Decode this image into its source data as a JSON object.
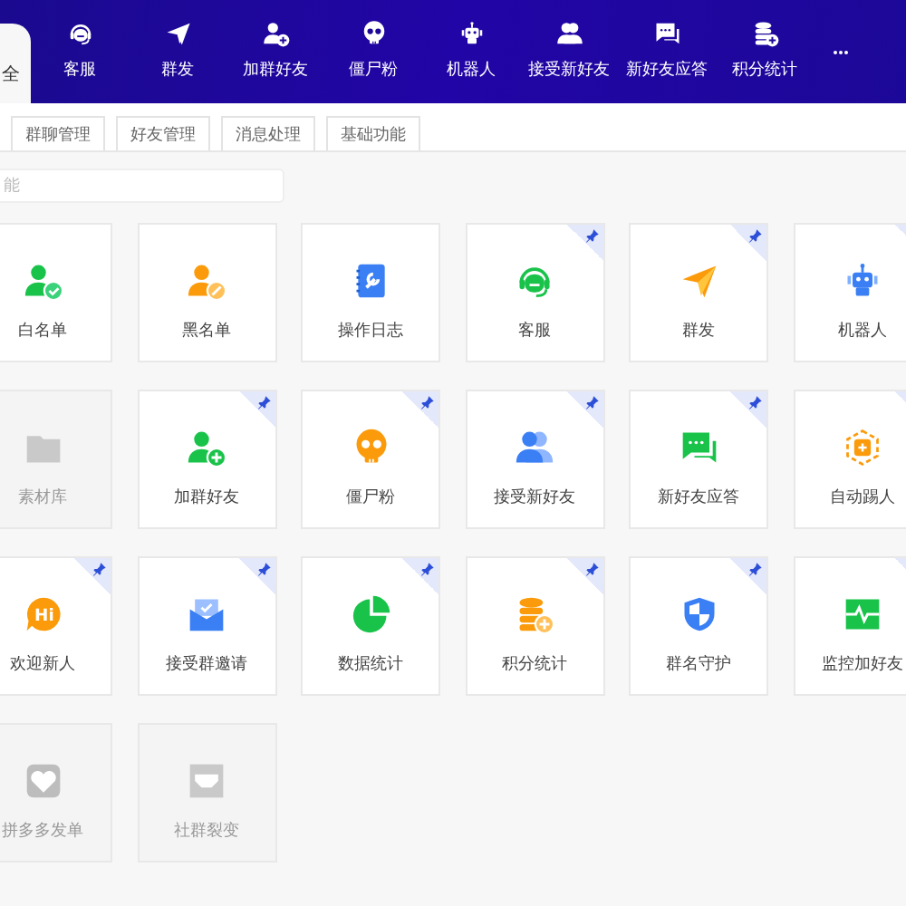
{
  "nav": {
    "current_tab": {
      "label": "全",
      "selected": true
    },
    "items": [
      {
        "label": "客服",
        "kind": "headset"
      },
      {
        "label": "群发",
        "kind": "send"
      },
      {
        "label": "加群好友",
        "kind": "user-add"
      },
      {
        "label": "僵尸粉",
        "kind": "skull"
      },
      {
        "label": "机器人",
        "kind": "robot"
      },
      {
        "label": "接受新好友",
        "kind": "users"
      },
      {
        "label": "新好友应答",
        "kind": "chat"
      },
      {
        "label": "积分统计",
        "kind": "coins"
      }
    ]
  },
  "tabs": [
    {
      "label": "群聊管理",
      "selected": false
    },
    {
      "label": "好友管理",
      "selected": false
    },
    {
      "label": "消息处理",
      "selected": false
    },
    {
      "label": "基础功能",
      "selected": false
    }
  ],
  "search": {
    "placeholder": "能"
  },
  "cards": [
    {
      "label": "白名单",
      "kind": "user-check",
      "pinned": false,
      "disabled": false
    },
    {
      "label": "黑名单",
      "kind": "user-edit",
      "pinned": false,
      "disabled": false
    },
    {
      "label": "操作日志",
      "kind": "book",
      "pinned": false,
      "disabled": false
    },
    {
      "label": "客服",
      "kind": "headset",
      "pinned": true,
      "disabled": false
    },
    {
      "label": "群发",
      "kind": "send",
      "pinned": true,
      "disabled": false
    },
    {
      "label": "机器人",
      "kind": "robot",
      "pinned": true,
      "disabled": false
    },
    {
      "label": "素材库",
      "kind": "folder",
      "pinned": false,
      "disabled": true
    },
    {
      "label": "加群好友",
      "kind": "user-add",
      "pinned": true,
      "disabled": false
    },
    {
      "label": "僵尸粉",
      "kind": "skull",
      "pinned": true,
      "disabled": false
    },
    {
      "label": "接受新好友",
      "kind": "users",
      "pinned": true,
      "disabled": false
    },
    {
      "label": "新好友应答",
      "kind": "chat",
      "pinned": true,
      "disabled": false
    },
    {
      "label": "自动踢人",
      "kind": "hexagon",
      "pinned": true,
      "disabled": false
    },
    {
      "label": "欢迎新人",
      "kind": "bubble",
      "icon_text": "Hi",
      "pinned": true,
      "disabled": false
    },
    {
      "label": "接受群邀请",
      "kind": "mail",
      "pinned": true,
      "disabled": false
    },
    {
      "label": "数据统计",
      "kind": "pie",
      "pinned": true,
      "disabled": false
    },
    {
      "label": "积分统计",
      "kind": "coins",
      "pinned": true,
      "disabled": false
    },
    {
      "label": "群名守护",
      "kind": "shield",
      "pinned": true,
      "disabled": false
    },
    {
      "label": "监控加好友",
      "kind": "pulse",
      "pinned": true,
      "disabled": false
    },
    {
      "label": "拼多多发单",
      "kind": "heart",
      "pinned": false,
      "disabled": true
    },
    {
      "label": "社群裂变",
      "kind": "flag",
      "pinned": false,
      "disabled": true
    }
  ]
}
